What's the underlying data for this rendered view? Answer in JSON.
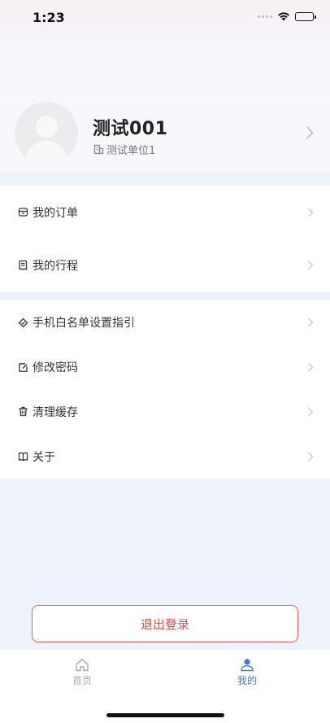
{
  "status_bar": {
    "time": "1:23"
  },
  "profile": {
    "name": "测试001",
    "unit": "测试单位1"
  },
  "menu_group_1": [
    {
      "label": "我的订单",
      "icon": "order-box-icon"
    },
    {
      "label": "我的行程",
      "icon": "itinerary-scroll-icon"
    }
  ],
  "menu_group_2": [
    {
      "label": "手机白名单设置指引",
      "icon": "whitelist-tag-icon"
    },
    {
      "label": "修改密码",
      "icon": "edit-password-icon"
    },
    {
      "label": "清理缓存",
      "icon": "trash-icon"
    },
    {
      "label": "关于",
      "icon": "book-icon"
    }
  ],
  "logout": {
    "label": "退出登录"
  },
  "tab_bar": {
    "tabs": [
      {
        "label": "首页",
        "icon": "home-icon",
        "active": false
      },
      {
        "label": "我的",
        "icon": "user-icon",
        "active": true
      }
    ]
  },
  "colors": {
    "accent": "#3a78f2",
    "danger": "#e04a4a",
    "page_bg": "#eef2fb"
  }
}
